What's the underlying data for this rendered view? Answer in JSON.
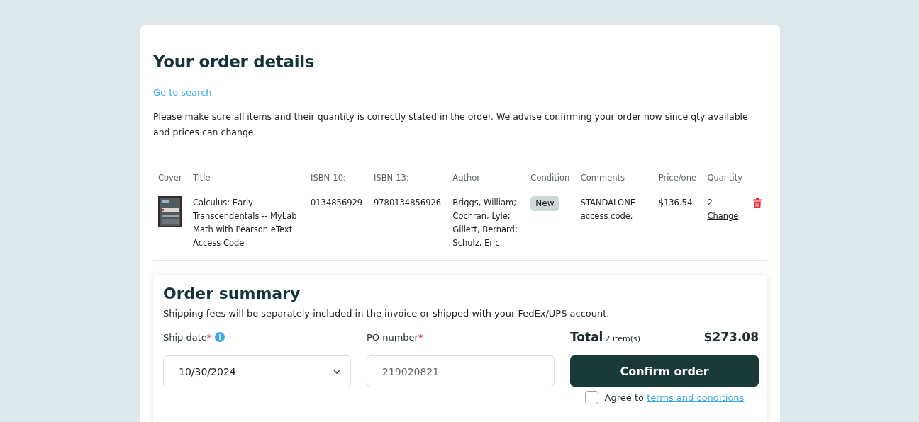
{
  "heading": "Your order details",
  "search_link": "Go to search",
  "notice": "Please make sure all items and their quantity is correctly stated in the order. We advise confirming your order now since qty available and prices can change.",
  "table": {
    "columns": [
      "Cover",
      "Title",
      "ISBN-10:",
      "ISBN-13:",
      "Author",
      "Condition",
      "Comments",
      "Price/one",
      "Quantity"
    ],
    "rows": [
      {
        "title": "Calculus: Early Transcendentals -- MyLab Math with Pearson eText Access Code",
        "isbn10": "0134856929",
        "isbn13": "9780134856926",
        "author": "Briggs, William; Cochran, Lyle; Gillett, Bernard; Schulz, Eric",
        "condition": "New",
        "comments": "STANDALONE access code.",
        "price": "$136.54",
        "quantity": "2",
        "change_link": "Change"
      }
    ]
  },
  "summary": {
    "title": "Order summary",
    "note": "Shipping fees will be separately included in the invoice or shipped with your FedEx/UPS account.",
    "fields": [
      {
        "kind": "select",
        "label": "Ship date",
        "required_mark": "*",
        "info": true,
        "value": "10/30/2024"
      },
      {
        "kind": "text",
        "label": "PO number",
        "required_mark": "*",
        "info": false,
        "placeholder": "219020821"
      }
    ],
    "total_label": "Total",
    "item_count": "2 item(s)",
    "total": "$273.08",
    "confirm_button": "Confirm order",
    "agree": {
      "checked": false,
      "text": "Agree to",
      "link": "terms and conditions"
    }
  }
}
